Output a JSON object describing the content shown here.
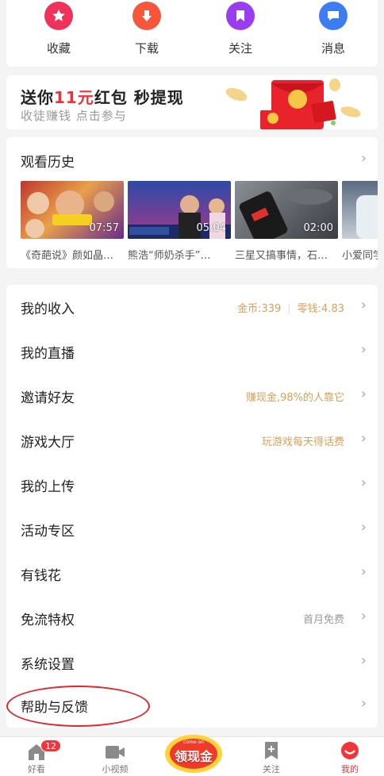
{
  "quick_actions": [
    {
      "label": "收藏",
      "icon": "star-icon",
      "color": "#f0325a"
    },
    {
      "label": "下载",
      "icon": "download-icon",
      "color": "#f5563c"
    },
    {
      "label": "关注",
      "icon": "bookmark-icon",
      "color": "#9a3cf0"
    },
    {
      "label": "消息",
      "icon": "message-icon",
      "color": "#3d7cf5"
    }
  ],
  "banner": {
    "title_prefix": "送你",
    "title_highlight": "11元",
    "title_suffix": "红包 秒提现",
    "subtitle": "收徒赚钱 点击参与"
  },
  "history": {
    "title": "观看历史",
    "videos": [
      {
        "duration": "07:57",
        "caption": "《奇葩说》颜如晶…"
      },
      {
        "duration": "05:04",
        "caption": "熊浩“师奶杀手”…"
      },
      {
        "duration": "02:00",
        "caption": "三星又搞事情，石…"
      },
      {
        "duration": "",
        "caption": "小爱同学"
      }
    ]
  },
  "menu": [
    {
      "label": "我的收入",
      "coins": "金币:339",
      "change": "零钱:4.83"
    },
    {
      "label": "我的直播",
      "value": ""
    },
    {
      "label": "邀请好友",
      "value": "赚现金,98%的人靠它"
    },
    {
      "label": "游戏大厅",
      "value": "玩游戏每天得话费"
    },
    {
      "label": "我的上传",
      "value": ""
    },
    {
      "label": "活动专区",
      "value": ""
    },
    {
      "label": "有钱花",
      "value": ""
    },
    {
      "label": "免流特权",
      "value": "首月免费"
    },
    {
      "label": "系统设置",
      "value": ""
    },
    {
      "label": "帮助与反馈",
      "value": ""
    }
  ],
  "promo_badge": "领现金",
  "promo_small": "come on",
  "tabbar": [
    {
      "label": "好看",
      "badge": "12"
    },
    {
      "label": "小视频"
    },
    {
      "label": "关注"
    },
    {
      "label": "我的"
    }
  ],
  "colors": {
    "accent": "#e8343a",
    "value_gold": "#d6a05a",
    "tab_active": "#f4343a"
  }
}
